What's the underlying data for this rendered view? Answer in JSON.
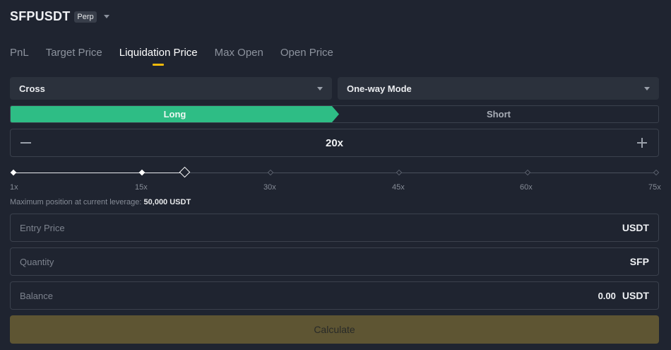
{
  "header": {
    "symbol": "SFPUSDT",
    "badge": "Perp"
  },
  "tabs": [
    {
      "label": "PnL",
      "active": false
    },
    {
      "label": "Target Price",
      "active": false
    },
    {
      "label": "Liquidation Price",
      "active": true
    },
    {
      "label": "Max Open",
      "active": false
    },
    {
      "label": "Open Price",
      "active": false
    }
  ],
  "margin_mode": {
    "value": "Cross"
  },
  "position_mode": {
    "value": "One-way Mode"
  },
  "side": {
    "long_label": "Long",
    "short_label": "Short",
    "selected": "Long"
  },
  "leverage": {
    "value_label": "20x",
    "value": 20,
    "min": 1,
    "max": 75,
    "ticks": [
      "1x",
      "15x",
      "30x",
      "45x",
      "60x",
      "75x"
    ]
  },
  "max_position": {
    "label": "Maximum position at current leverage:",
    "value": "50,000 USDT"
  },
  "fields": {
    "entry_price": {
      "placeholder": "Entry Price",
      "value": "",
      "unit": "USDT"
    },
    "quantity": {
      "placeholder": "Quantity",
      "value": "",
      "unit": "SFP"
    },
    "balance": {
      "placeholder": "Balance",
      "amount": "0.00",
      "unit": "USDT"
    }
  },
  "calculate_label": "Calculate",
  "colors": {
    "long": "#2ebd85",
    "accent": "#f0b90b",
    "calculate_bg": "#5e5533",
    "background": "#1f2430"
  }
}
